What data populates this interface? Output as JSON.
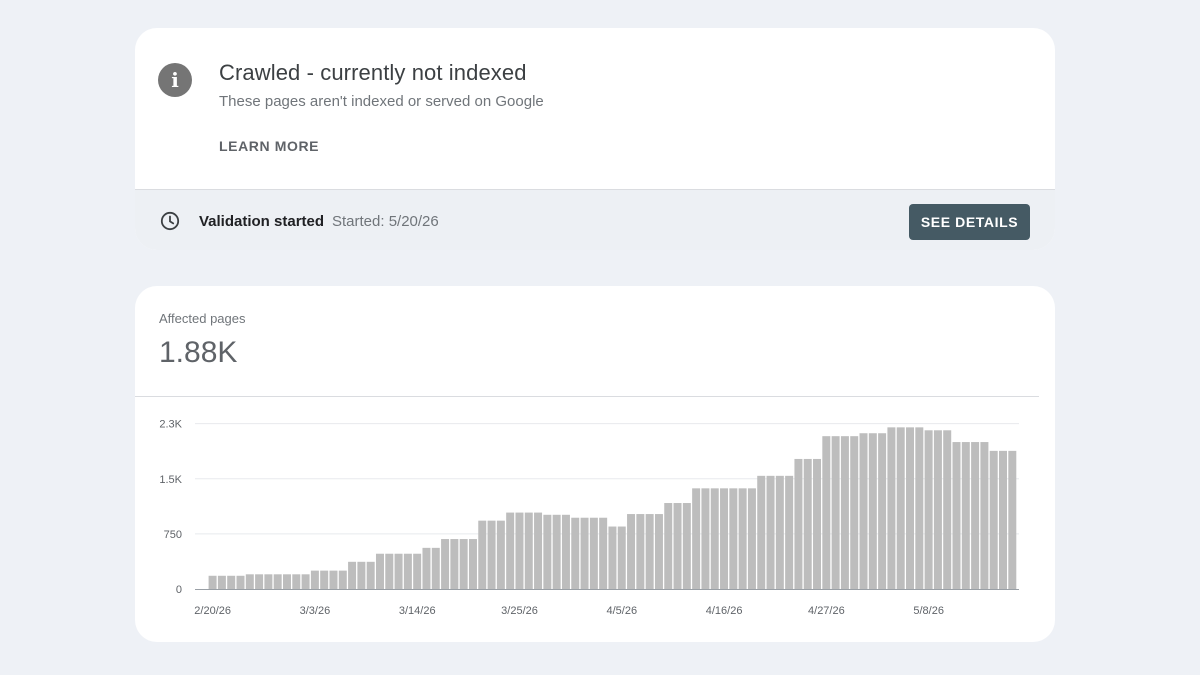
{
  "issue": {
    "title": "Crawled - currently not indexed",
    "subtitle": "These pages aren't indexed or served on Google",
    "learn_more": "LEARN MORE",
    "info_icon_glyph": "i"
  },
  "validation": {
    "label": "Validation started",
    "started": "Started: 5/20/26",
    "button": "SEE DETAILS"
  },
  "summary": {
    "label": "Affected pages",
    "value": "1.88K"
  },
  "colors": {
    "bar": "#bdbdbd",
    "button": "#455a64",
    "background": "#eef1f6"
  },
  "chart_data": {
    "type": "bar",
    "ylim": [
      0,
      2300
    ],
    "yticks": [
      {
        "value": 0,
        "label": "0"
      },
      {
        "value": 750,
        "label": "750"
      },
      {
        "value": 1500,
        "label": "1.5K"
      },
      {
        "value": 2250,
        "label": "2.3K"
      }
    ],
    "xticks": [
      {
        "index": 0,
        "label": "2/20/26"
      },
      {
        "index": 11,
        "label": "3/3/26"
      },
      {
        "index": 22,
        "label": "3/14/26"
      },
      {
        "index": 33,
        "label": "3/25/26"
      },
      {
        "index": 44,
        "label": "4/5/26"
      },
      {
        "index": 55,
        "label": "4/16/26"
      },
      {
        "index": 66,
        "label": "4/27/26"
      },
      {
        "index": 77,
        "label": "5/8/26"
      }
    ],
    "values": [
      180,
      180,
      180,
      180,
      200,
      200,
      200,
      200,
      200,
      200,
      200,
      250,
      250,
      250,
      250,
      370,
      370,
      370,
      480,
      480,
      480,
      480,
      480,
      560,
      560,
      680,
      680,
      680,
      680,
      930,
      930,
      930,
      1040,
      1040,
      1040,
      1040,
      1010,
      1010,
      1010,
      970,
      970,
      970,
      970,
      850,
      850,
      1020,
      1020,
      1020,
      1020,
      1170,
      1170,
      1170,
      1370,
      1370,
      1370,
      1370,
      1370,
      1370,
      1370,
      1540,
      1540,
      1540,
      1540,
      1770,
      1770,
      1770,
      2080,
      2080,
      2080,
      2080,
      2120,
      2120,
      2120,
      2200,
      2200,
      2200,
      2200,
      2160,
      2160,
      2160,
      2000,
      2000,
      2000,
      2000,
      1880,
      1880,
      1880
    ]
  }
}
